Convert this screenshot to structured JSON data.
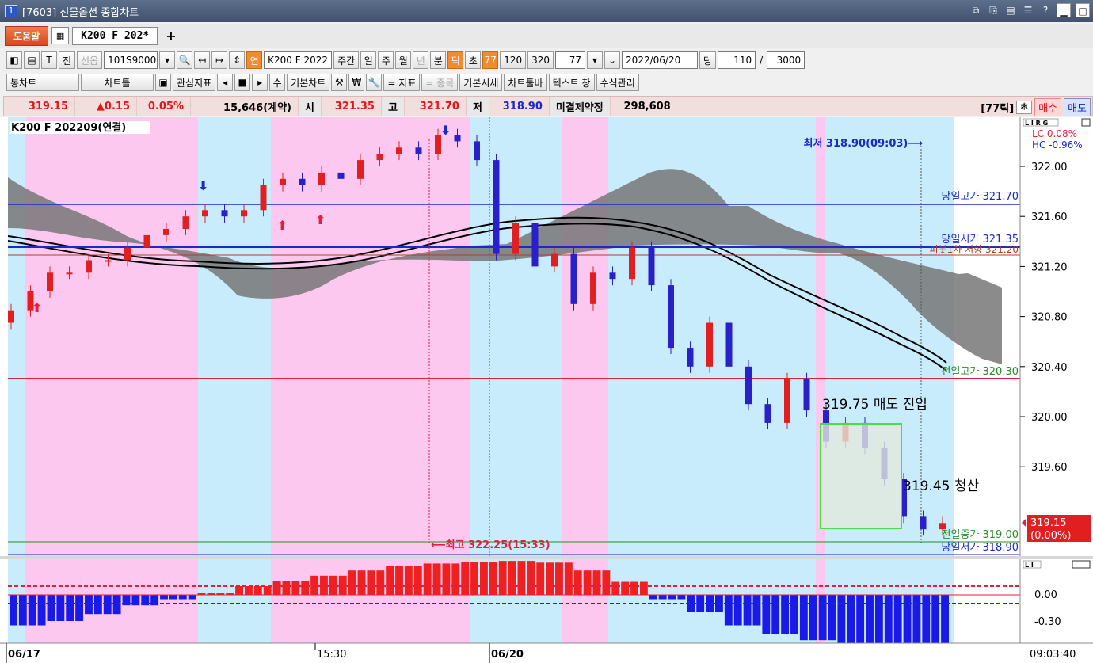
{
  "window": {
    "number": "1",
    "title": "[7603] 선물옵션 종합차트"
  },
  "tabs": {
    "help_label": "도움말",
    "active_tab": "K200 F 202*",
    "add_label": "+"
  },
  "toolbar": {
    "prefix_btn": "전",
    "sel_btn": "선옵",
    "code_value": "101S9000",
    "name_value": "K200 F 2022",
    "period_btn": "주간",
    "units": [
      "일",
      "주",
      "월",
      "년",
      "분",
      "틱",
      "초"
    ],
    "active_unit": "틱",
    "tick_btns": [
      "77",
      "120",
      "320"
    ],
    "tick_value": "77",
    "date_value": "2022/06/20",
    "per_label": "당",
    "count_value": "110",
    "total_value": "3000",
    "extra_btn": "연"
  },
  "toolbar2": {
    "chart_type": "봉차트",
    "chart_frame": "차트틀",
    "indicator": "관심지표",
    "plus_label": "수",
    "base_chart": "기본차트",
    "krw": "₩",
    "indicator_btn": "= 지표",
    "item_btn": "= 종목",
    "basic_quote": "기본시세",
    "chart_toolbar": "차트툴바",
    "text_window": "텍스트 창",
    "formula": "수식관리"
  },
  "quote": {
    "price": "319.15",
    "change": "▲0.15",
    "change_pct": "0.05%",
    "volume": "15,646(계약)",
    "open_label": "시",
    "open": "321.35",
    "high_label": "고",
    "high": "321.70",
    "low_label": "저",
    "low": "318.90",
    "oi_label": "미결제약정",
    "oi": "298,608",
    "tick_label": "[77틱]",
    "buy_label": "매수",
    "sell_label": "매도"
  },
  "chart": {
    "title": "K200 F 202209(연결)",
    "lc": "LC  0.08%",
    "hc": "HC -0.96%",
    "lines": {
      "today_high": "당일고가 321.70",
      "today_open": "당일시가 321.35",
      "pivot": "피봇1차 저항 321.20",
      "prev_high": "전일고가 320.30",
      "prev_close": "전일종가 319.00",
      "today_low": "당일저가 318.90"
    },
    "annotations": {
      "low_note": "최저 318.90(09:03)⟶",
      "high_note": "⟵최고 322.25(15:33)",
      "entry": "319.75 매도 진입",
      "exit": "319.45 청산"
    },
    "last_price": "319.15",
    "last_pct": "(0.00%)",
    "xaxis": {
      "d1": "06/17",
      "t1": "15:30",
      "d2": "06/20",
      "clock": "09:03:40"
    }
  },
  "chart_data": {
    "type": "candlestick",
    "yaxis_ticks": [
      "322.00",
      "321.60",
      "321.20",
      "320.80",
      "320.40",
      "320.00",
      "319.60"
    ],
    "yaxis_range": [
      318.9,
      322.4
    ],
    "osc_ticks": [
      "0.00",
      "-0.30"
    ],
    "closes": [
      320.85,
      321.0,
      321.15,
      321.15,
      321.25,
      321.25,
      321.35,
      321.45,
      321.5,
      321.6,
      321.65,
      321.6,
      321.65,
      321.85,
      321.9,
      321.85,
      321.95,
      321.9,
      322.05,
      322.1,
      322.15,
      322.1,
      322.25,
      322.2,
      322.05,
      321.3,
      321.55,
      321.2,
      321.3,
      320.9,
      321.15,
      321.1,
      321.35,
      321.05,
      320.55,
      320.4,
      320.75,
      320.4,
      320.1,
      319.95,
      320.3,
      320.05,
      319.8,
      319.95,
      319.75,
      319.5,
      319.2,
      319.1,
      319.15
    ],
    "osc_values": [
      -0.35,
      -0.3,
      -0.22,
      -0.12,
      -0.05,
      0.02,
      0.1,
      0.16,
      0.22,
      0.28,
      0.33,
      0.36,
      0.38,
      0.39,
      0.37,
      0.28,
      0.15,
      -0.05,
      -0.2,
      -0.35,
      -0.45,
      -0.52,
      -0.58,
      -0.62,
      -0.66
    ]
  }
}
